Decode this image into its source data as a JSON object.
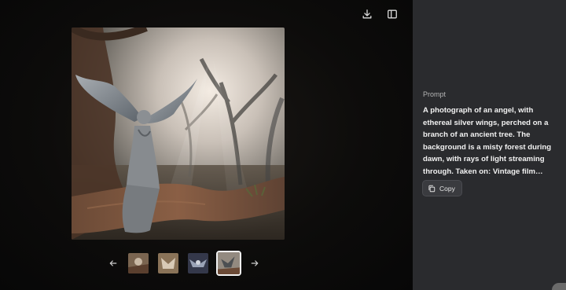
{
  "toolbar": {
    "download_icon": "download-icon",
    "sidebar_toggle_icon": "sidebar-toggle-icon"
  },
  "gallery": {
    "main_image_alt": "image-of-angel-on-branch",
    "prev_icon": "arrow-left-icon",
    "next_icon": "arrow-right-icon",
    "thumbnails": [
      {
        "selected": false
      },
      {
        "selected": false
      },
      {
        "selected": false
      },
      {
        "selected": true
      }
    ]
  },
  "sidebar": {
    "prompt_label": "Prompt",
    "prompt_text": "A photograph of an angel, with ethereal silver wings, perched on a branch of an ancient tree. The background is a misty forest during dawn, with rays of light streaming through. Taken on: Vintage film camera, landscape photography, natural light",
    "copy_label": "Copy",
    "copy_icon": "copy-icon"
  }
}
